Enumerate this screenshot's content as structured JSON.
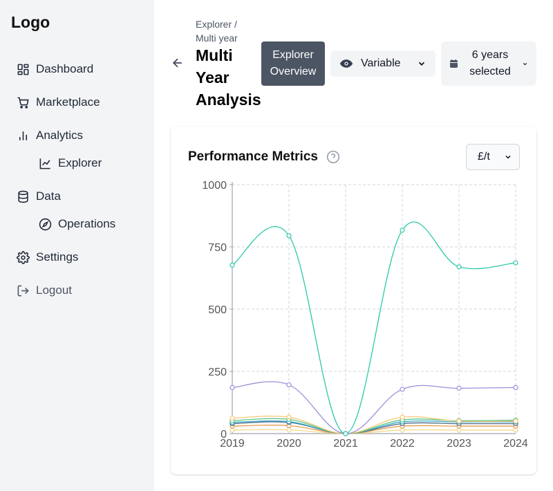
{
  "sidebar": {
    "logo": "Logo",
    "items": [
      {
        "label": "Dashboard",
        "icon": "grid-icon"
      },
      {
        "label": "Marketplace",
        "icon": "cart-icon"
      },
      {
        "label": "Analytics",
        "icon": "bar-chart-icon"
      },
      {
        "label": "Explorer",
        "icon": "line-chart-icon"
      },
      {
        "label": "Data",
        "icon": "database-icon"
      },
      {
        "label": "Operations",
        "icon": "compass-icon"
      },
      {
        "label": "Settings",
        "icon": "gear-icon"
      },
      {
        "label": "Logout",
        "icon": "logout-icon"
      }
    ]
  },
  "header": {
    "breadcrumb": "Explorer / Multi year",
    "title": "Multi Year Analysis",
    "explorer_overview_label": "Explorer Overview",
    "variable_label": "Variable",
    "years_label": "6 years selected"
  },
  "card": {
    "title": "Performance Metrics",
    "unit": "£/t"
  },
  "chart_data": {
    "type": "line",
    "x": [
      "2019",
      "2020",
      "2021",
      "2022",
      "2023",
      "2024"
    ],
    "ylim": [
      0,
      1000
    ],
    "yticks": [
      0,
      250,
      500,
      750,
      1000
    ],
    "grid": true,
    "series": [
      {
        "color": "#2dc8a8",
        "values": [
          677,
          795,
          0,
          817,
          670,
          686
        ]
      },
      {
        "color": "#9b8fd9",
        "values": [
          185,
          196,
          0,
          178,
          182,
          185
        ]
      },
      {
        "color": "#f7c873",
        "values": [
          62,
          66,
          0,
          66,
          50,
          50
        ]
      },
      {
        "color": "#5cc48a",
        "values": [
          52,
          57,
          0,
          55,
          52,
          54
        ]
      },
      {
        "color": "#3aa9c4",
        "values": [
          45,
          48,
          0,
          47,
          47,
          47
        ]
      },
      {
        "color": "#4a6b8a",
        "values": [
          40,
          45,
          0,
          40,
          40,
          40
        ]
      },
      {
        "color": "#e89a4d",
        "values": [
          30,
          32,
          0,
          30,
          30,
          30
        ]
      },
      {
        "color": "#f3d98a",
        "values": [
          14,
          15,
          0,
          14,
          14,
          14
        ]
      }
    ]
  }
}
